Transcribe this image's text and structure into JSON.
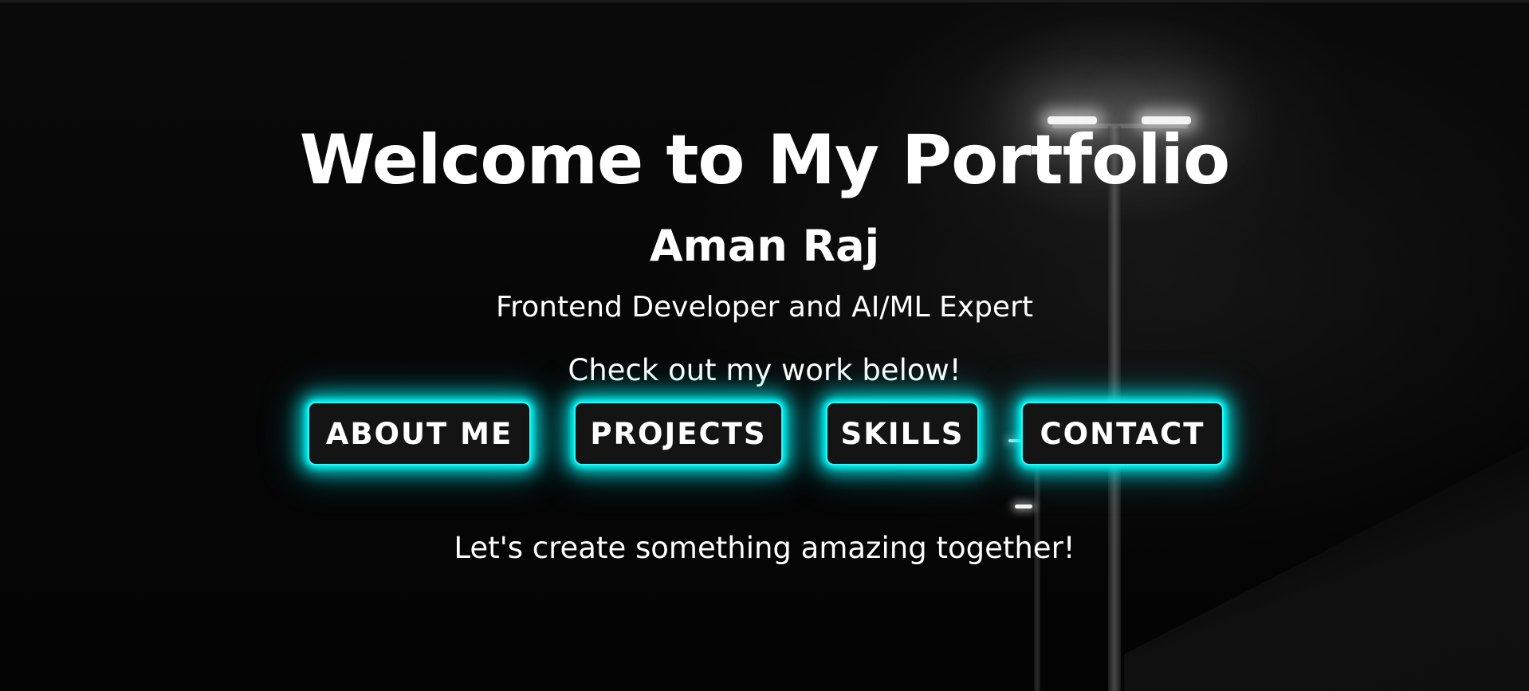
{
  "hero": {
    "title": "Welcome to My Portfolio",
    "name": "Aman Raj",
    "tagline": "Frontend Developer and AI/ML Expert",
    "cta_text": "Check out my work below!",
    "footer_text": "Let's create something amazing together!"
  },
  "nav": {
    "buttons": [
      {
        "label": "ABOUT ME"
      },
      {
        "label": "PROJECTS"
      },
      {
        "label": "SKILLS"
      },
      {
        "label": "CONTACT"
      }
    ]
  },
  "colors": {
    "background": "#050505",
    "text": "#ffffff",
    "button_glow": "#00ffff",
    "button_fill": "#141414"
  }
}
